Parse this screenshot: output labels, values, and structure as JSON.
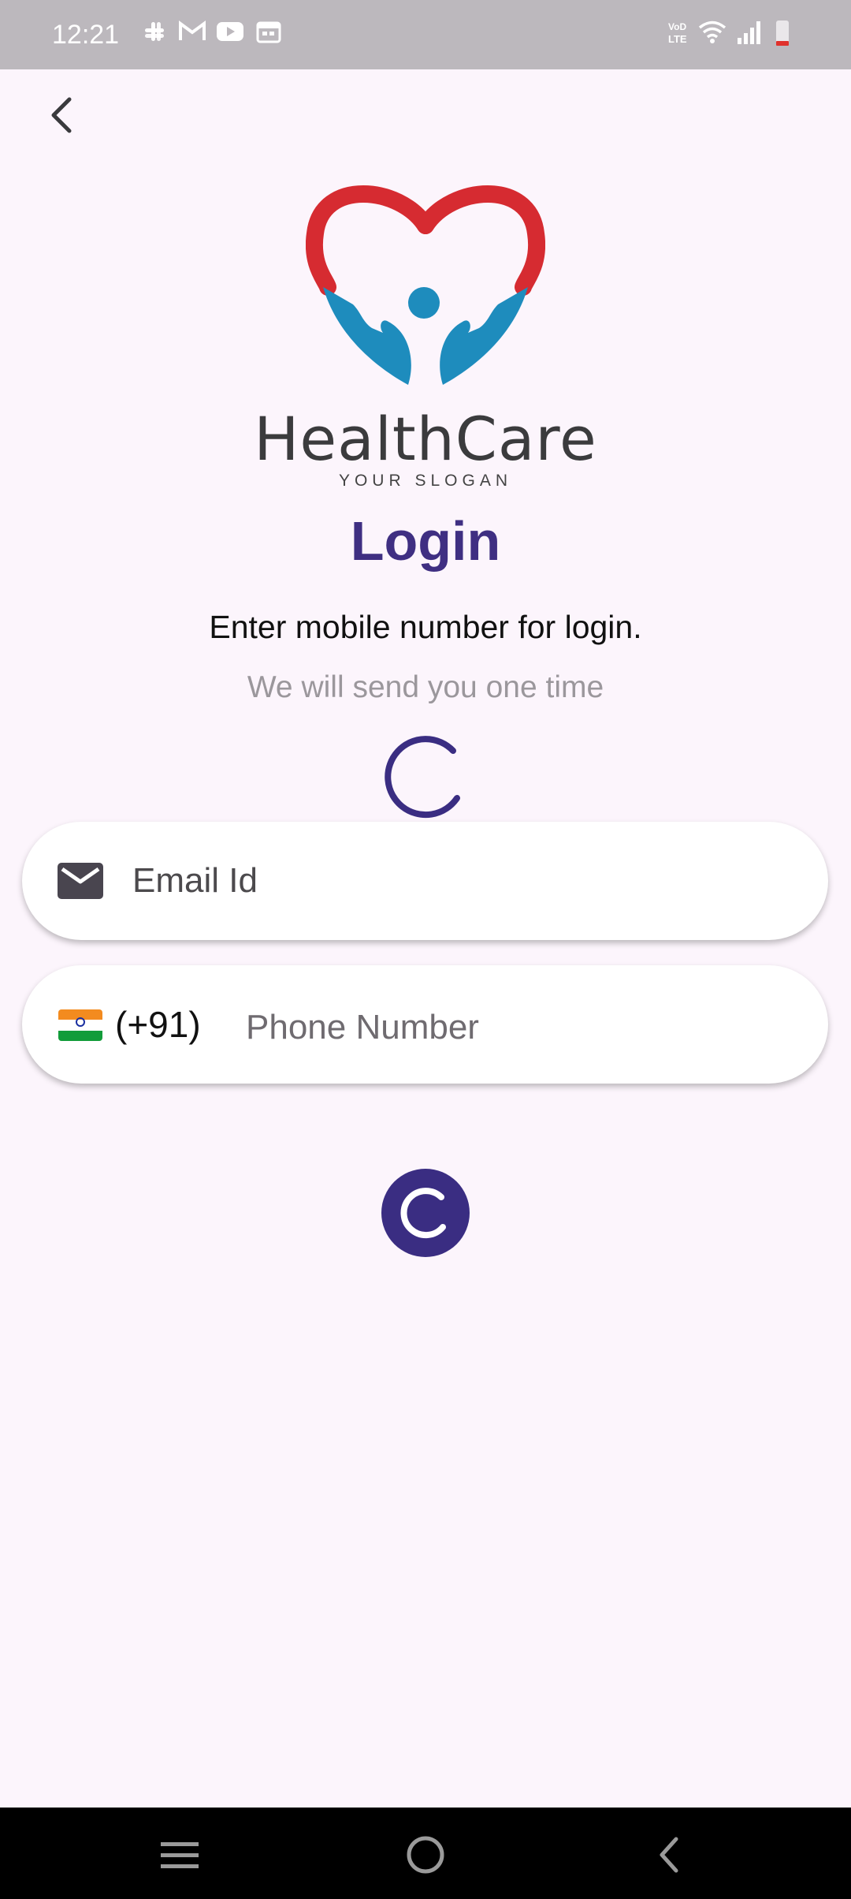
{
  "status_bar": {
    "time": "12:21",
    "notification_icons": [
      "slack-icon",
      "gmail-icon",
      "youtube-icon",
      "calendar-icon"
    ],
    "system_icons": [
      "volte-icon",
      "wifi-icon",
      "signal-icon",
      "battery-icon"
    ]
  },
  "nav": {
    "back_icon": "chevron-left-icon"
  },
  "logo": {
    "brand": "HealthCare",
    "slogan": "YOUR SLOGAN",
    "heart_color": "#d62b31",
    "hands_color": "#1e8cbd"
  },
  "page": {
    "title": "Login",
    "subtitle": "Enter mobile number for login.",
    "helper": "We will send you one time"
  },
  "email_field": {
    "icon": "mail-icon",
    "placeholder": "Email Id"
  },
  "phone_field": {
    "flag": "india-flag-icon",
    "country_code": "(+91)",
    "placeholder": "Phone Number"
  },
  "colors": {
    "accent": "#3f2f82",
    "background": "#fcf5fc"
  },
  "system_nav": {
    "items": [
      "recents-icon",
      "home-icon",
      "back-icon"
    ]
  }
}
